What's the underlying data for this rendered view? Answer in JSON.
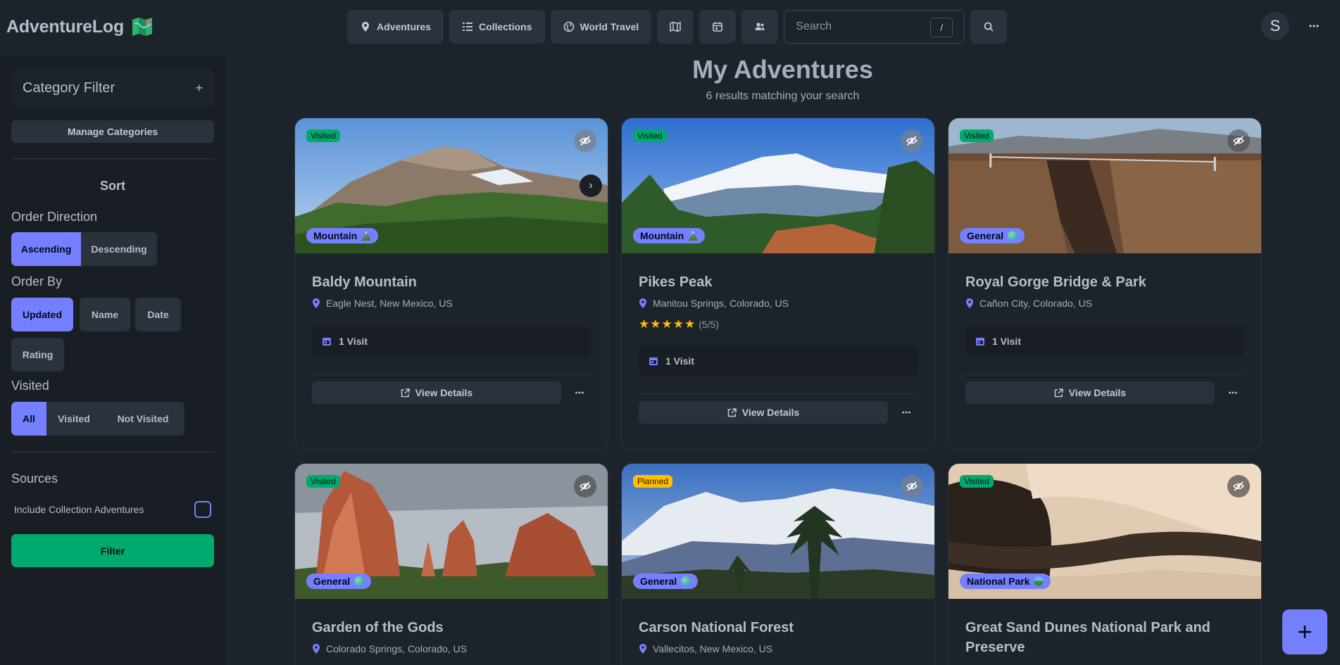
{
  "brand": {
    "name": "AdventureLog"
  },
  "nav": {
    "adventures": "Adventures",
    "collections": "Collections",
    "world_travel": "World Travel",
    "search_placeholder": "Search",
    "search_shortcut": "/",
    "avatar_initial": "S"
  },
  "sidebar": {
    "category_filter": "Category Filter",
    "category_add": "+",
    "manage_categories": "Manage Categories",
    "sort_title": "Sort",
    "order_direction_label": "Order Direction",
    "order_direction": [
      "Ascending",
      "Descending"
    ],
    "order_direction_selected": "Ascending",
    "order_by_label": "Order By",
    "order_by": [
      "Updated",
      "Name",
      "Date",
      "Rating"
    ],
    "order_by_selected": "Updated",
    "visited_label": "Visited",
    "visited_options": [
      "All",
      "Visited",
      "Not Visited"
    ],
    "visited_selected": "All",
    "sources_label": "Sources",
    "include_collection": "Include Collection Adventures",
    "filter_button": "Filter"
  },
  "main": {
    "title": "My Adventures",
    "subtitle": "6 results matching your search"
  },
  "card_labels": {
    "view_details": "View Details"
  },
  "adventures": [
    {
      "name": "Baldy Mountain",
      "location": "Eagle Nest, New Mexico, US",
      "status": "Visited",
      "category": "Mountain",
      "visits": "1 Visit",
      "rating": null
    },
    {
      "name": "Pikes Peak",
      "location": "Manitou Springs, Colorado, US",
      "status": "Visited",
      "category": "Mountain",
      "visits": "1 Visit",
      "rating": "(5/5)"
    },
    {
      "name": "Royal Gorge Bridge & Park",
      "location": "Cañon City, Colorado, US",
      "status": "Visited",
      "category": "General",
      "visits": "1 Visit",
      "rating": null
    },
    {
      "name": "Garden of the Gods",
      "location": "Colorado Springs, Colorado, US",
      "status": "Visited",
      "category": "General",
      "visits": null,
      "rating": null
    },
    {
      "name": "Carson National Forest",
      "location": "Vallecitos, New Mexico, US",
      "status": "Planned",
      "category": "General",
      "visits": null,
      "rating": null
    },
    {
      "name": "Great Sand Dunes National Park and Preserve",
      "location": "",
      "status": "Visited",
      "category": "National Park",
      "visits": null,
      "rating": null
    }
  ],
  "colors": {
    "primary": "#7480ff",
    "success": "#00a96e",
    "warning": "#ffbe00",
    "base": "#1d232a"
  }
}
